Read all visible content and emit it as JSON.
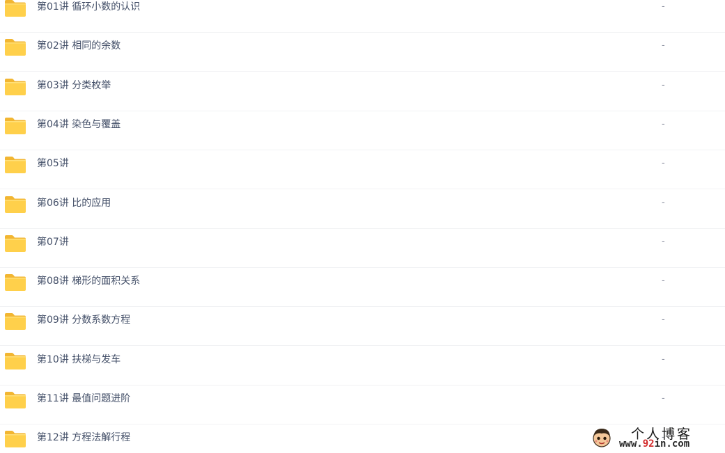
{
  "files": [
    {
      "name": "第01讲 循环小数的认识",
      "size": "-"
    },
    {
      "name": "第02讲 相同的余数",
      "size": "-"
    },
    {
      "name": "第03讲 分类枚举",
      "size": "-"
    },
    {
      "name": "第04讲 染色与覆盖",
      "size": "-"
    },
    {
      "name": "第05讲",
      "size": "-"
    },
    {
      "name": "第06讲 比的应用",
      "size": "-"
    },
    {
      "name": "第07讲",
      "size": "-"
    },
    {
      "name": "第08讲 梯形的面积关系",
      "size": "-"
    },
    {
      "name": "第09讲 分数系数方程",
      "size": "-"
    },
    {
      "name": "第10讲 扶梯与发车",
      "size": "-"
    },
    {
      "name": "第11讲 最值问题进阶",
      "size": "-"
    },
    {
      "name": "第12讲 方程法解行程",
      "size": "-"
    }
  ],
  "watermark": {
    "title": "个人博客",
    "url_prefix": "www.",
    "url_number": "92",
    "url_suffix": "in.com"
  },
  "icons": {
    "folder": "folder-icon",
    "watermark": "cartoon-face-icon"
  },
  "colors": {
    "folder_body": "#ffd04b",
    "folder_tab": "#f2b632",
    "text": "#424e67",
    "size_text": "#878c9c",
    "row_divider": "#f1f2f4"
  }
}
